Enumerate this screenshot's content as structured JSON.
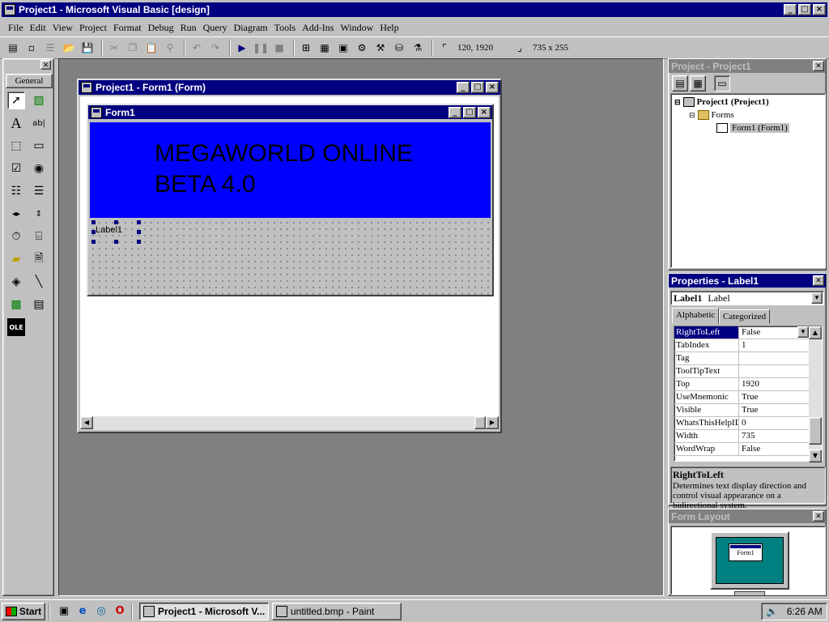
{
  "app": {
    "title": "Project1 - Microsoft Visual Basic [design]"
  },
  "menu": [
    "File",
    "Edit",
    "View",
    "Project",
    "Format",
    "Debug",
    "Run",
    "Query",
    "Diagram",
    "Tools",
    "Add-Ins",
    "Window",
    "Help"
  ],
  "toolbar": {
    "position": "120, 1920",
    "size": "735 x 255"
  },
  "toolbox": {
    "tab": "General"
  },
  "designer": {
    "title": "Project1 - Form1 (Form)",
    "form_title": "Form1",
    "banner_line1": "MEGAWORLD ONLINE",
    "banner_line2": "BETA 4.0",
    "label": "Label1"
  },
  "project": {
    "title": "Project - Project1",
    "root": "Project1 (Project1)",
    "folder": "Forms",
    "form": "Form1 (Form1)"
  },
  "properties": {
    "title": "Properties - Label1",
    "object_name": "Label1",
    "object_type": "Label",
    "tab_alpha": "Alphabetic",
    "tab_cat": "Categorized",
    "rows": [
      {
        "name": "RightToLeft",
        "value": "False"
      },
      {
        "name": "TabIndex",
        "value": "1"
      },
      {
        "name": "Tag",
        "value": ""
      },
      {
        "name": "ToolTipText",
        "value": ""
      },
      {
        "name": "Top",
        "value": "1920"
      },
      {
        "name": "UseMnemonic",
        "value": "True"
      },
      {
        "name": "Visible",
        "value": "True"
      },
      {
        "name": "WhatsThisHelpID",
        "value": "0"
      },
      {
        "name": "Width",
        "value": "735"
      },
      {
        "name": "WordWrap",
        "value": "False"
      }
    ],
    "desc_title": "RightToLeft",
    "desc_text": "Determines text display direction and control visual appearance on a bidirectional system."
  },
  "layout": {
    "title": "Form Layout",
    "mini_form": "Form1"
  },
  "taskbar": {
    "start": "Start",
    "tasks": [
      "Project1 - Microsoft V...",
      "untitled.bmp - Paint"
    ],
    "clock": "6:26 AM"
  },
  "colors": {
    "active_title": "#000080",
    "banner": "#0000ff",
    "desktop_teal": "#008080"
  }
}
